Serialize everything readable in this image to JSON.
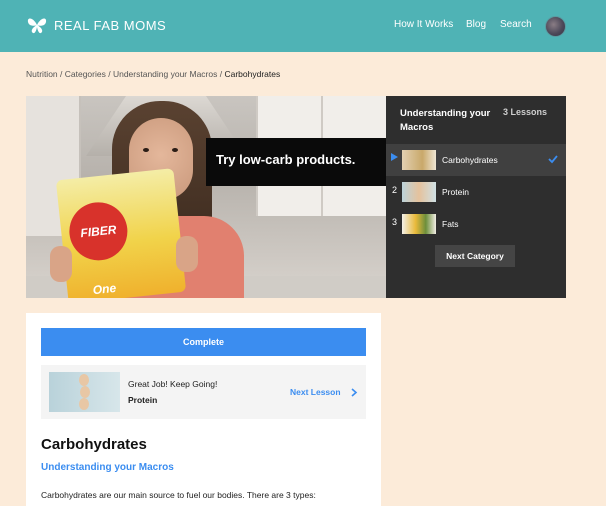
{
  "header": {
    "logo_text": "REAL FAB MOMS",
    "logo_icon": "butterfly-icon",
    "nav": [
      "How It Works",
      "Blog",
      "Search"
    ]
  },
  "breadcrumb": {
    "items": [
      "Nutrition",
      "Categories",
      "Understanding your Macros"
    ],
    "separator": " / ",
    "current": "Carbohydrates"
  },
  "video": {
    "caption": "Try low-carb products.",
    "package_text": "FIBER One"
  },
  "lessons_panel": {
    "title": "Understanding your Macros",
    "count": "3 Lessons",
    "lessons": [
      {
        "num": "",
        "label": "Carbohydrates",
        "completed": true,
        "active": true
      },
      {
        "num": "2",
        "label": "Protein",
        "completed": false,
        "active": false
      },
      {
        "num": "3",
        "label": "Fats",
        "completed": false,
        "active": false
      }
    ],
    "next_category": "Next Category"
  },
  "content": {
    "complete_label": "Complete",
    "next_message": "Great Job! Keep Going!",
    "next_lesson_name": "Protein",
    "next_lesson_link": "Next Lesson",
    "title": "Carbohydrates",
    "category": "Understanding your Macros",
    "body": "Carbohydrates are our main source to fuel our bodies. There are 3 types:"
  },
  "colors": {
    "header_bg": "#4fb3b5",
    "page_bg": "#fcebd9",
    "accent": "#3b8df0",
    "panel_bg": "#2e2e2e"
  }
}
